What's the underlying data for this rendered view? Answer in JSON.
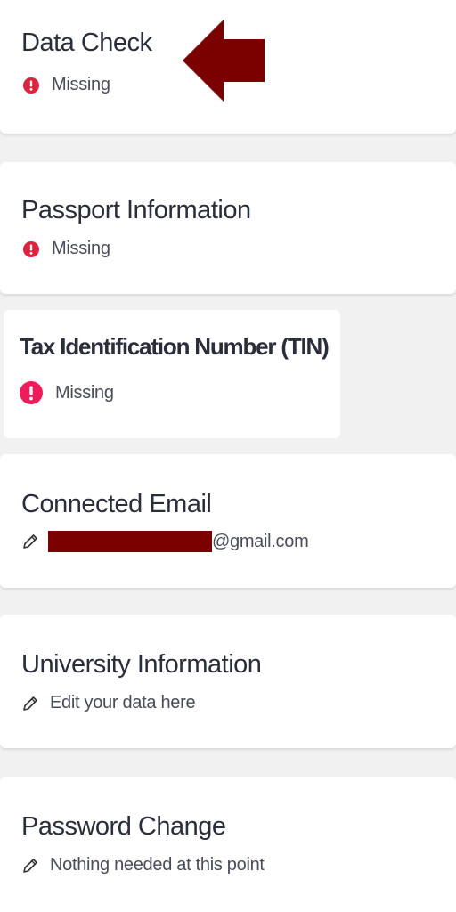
{
  "colors": {
    "background": "#f1f1f2",
    "card": "#ffffff",
    "title_text": "#2b2d3a",
    "alert_red": "#d8243f",
    "alert_pink": "#ee1c5b",
    "arrow": "#7b0000",
    "redaction": "#7b0000"
  },
  "cards": {
    "data_check": {
      "title": "Data Check",
      "status": "Missing",
      "status_icon": "exclamation-circle-icon",
      "annotation_icon": "left-arrow-icon"
    },
    "passport": {
      "title": "Passport Information",
      "status": "Missing",
      "status_icon": "exclamation-circle-icon"
    },
    "tin": {
      "title": "Tax Identification Number (TIN)",
      "status": "Missing",
      "status_icon": "exclamation-circle-icon"
    },
    "email": {
      "title": "Connected Email",
      "email_suffix": "@gmail.com",
      "edit_icon": "pencil-icon"
    },
    "university": {
      "title": "University Information",
      "hint": "Edit your data here",
      "edit_icon": "pencil-icon"
    },
    "password": {
      "title": "Password Change",
      "hint": "Nothing needed at this point",
      "edit_icon": "pencil-icon"
    }
  }
}
